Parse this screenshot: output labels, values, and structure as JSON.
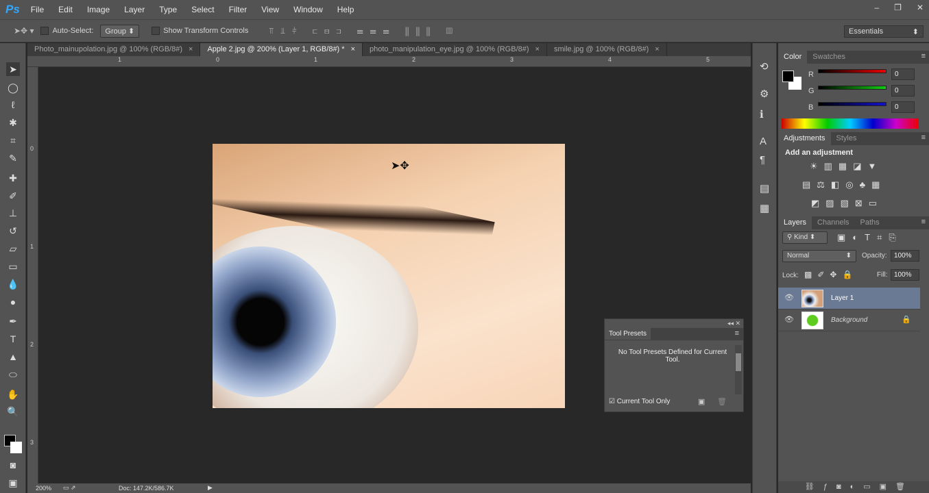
{
  "app": {
    "logo": "Ps",
    "menu": [
      "File",
      "Edit",
      "Image",
      "Layer",
      "Type",
      "Select",
      "Filter",
      "View",
      "Window",
      "Help"
    ],
    "window_controls": [
      "–",
      "❐",
      "✕"
    ]
  },
  "options": {
    "auto_select_label": "Auto-Select:",
    "group_value": "Group",
    "show_transform_label": "Show Transform Controls",
    "workspace": "Essentials"
  },
  "tabs": [
    {
      "label": "Photo_mainupolation.jpg @ 100% (RGB/8#)",
      "close": "×"
    },
    {
      "label": "Apple 2.jpg @ 200% (Layer 1, RGB/8#) *",
      "close": "×",
      "active": true
    },
    {
      "label": "photo_manipulation_eye.jpg @ 100% (RGB/8#)",
      "close": "×"
    },
    {
      "label": "smile.jpg @ 100% (RGB/8#)",
      "close": "×"
    }
  ],
  "rulers": {
    "h": [
      "1",
      "0",
      "1",
      "2",
      "3",
      "4",
      "5"
    ],
    "v": [
      "0",
      "1",
      "2",
      "3"
    ]
  },
  "status": {
    "zoom": "200%",
    "doc": "Doc: 147.2K/586.7K"
  },
  "color_panel": {
    "tabs": [
      "Color",
      "Swatches"
    ],
    "channels": [
      {
        "label": "R",
        "value": "0"
      },
      {
        "label": "G",
        "value": "0"
      },
      {
        "label": "B",
        "value": "0"
      }
    ]
  },
  "adjustments_panel": {
    "tabs": [
      "Adjustments",
      "Styles"
    ],
    "heading": "Add an adjustment"
  },
  "layers_panel": {
    "tabs": [
      "Layers",
      "Channels",
      "Paths"
    ],
    "filter": "Kind",
    "blend_mode": "Normal",
    "opacity_label": "Opacity:",
    "opacity": "100%",
    "lock_label": "Lock:",
    "fill_label": "Fill:",
    "fill": "100%",
    "layers": [
      {
        "name": "Layer 1",
        "selected": true
      },
      {
        "name": "Background",
        "locked": true
      }
    ]
  },
  "tool_presets": {
    "title": "Tool Presets",
    "message": "No Tool Presets Defined for Current Tool.",
    "current_only_label": "Current Tool Only"
  }
}
